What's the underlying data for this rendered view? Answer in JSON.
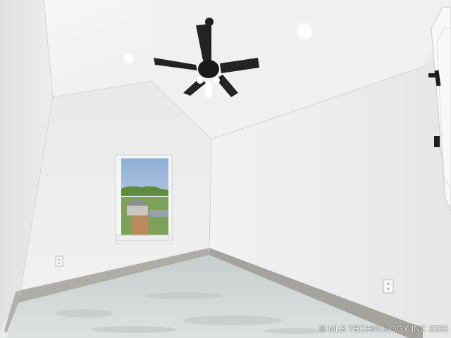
{
  "photo": {
    "watermark": "© MLS TECHNOLOGY INC 2025"
  },
  "colors": {
    "wall": "#ecedec",
    "ceiling": "#f4f5f4",
    "floor": "#d7dbdb",
    "baseboard": "#a9a8a3",
    "fan": "#1d1d1d",
    "window_sky": "#a9c0dc",
    "window_trees": "#5f8a3e"
  },
  "objects": [
    "ceiling-fan",
    "window",
    "recessed-light",
    "electrical-outlet",
    "barn-door",
    "baseboard",
    "concrete-floor"
  ]
}
